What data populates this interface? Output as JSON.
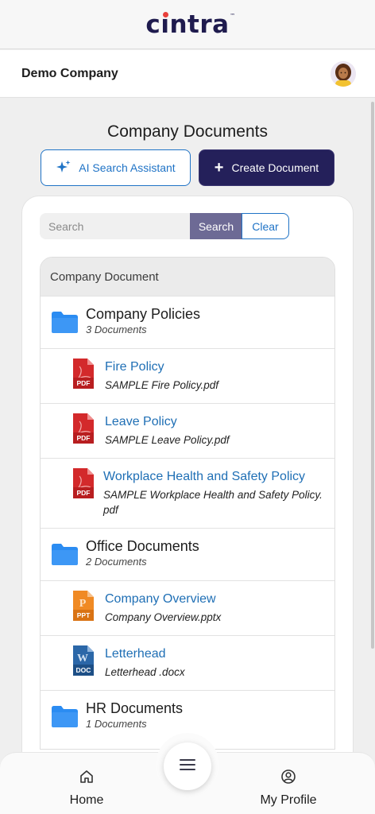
{
  "app": {
    "logo_text": "cintra",
    "logo_tm": "™"
  },
  "company": {
    "name": "Demo Company"
  },
  "page": {
    "title": "Company Documents"
  },
  "actions": {
    "ai_search_label": "AI Search Assistant",
    "create_label": "Create Document"
  },
  "search": {
    "placeholder": "Search",
    "search_label": "Search",
    "clear_label": "Clear"
  },
  "list": {
    "header": "Company Document",
    "folders": [
      {
        "title": "Company Policies",
        "count": "3 Documents",
        "files": [
          {
            "title": "Fire Policy",
            "filename": "SAMPLE Fire Policy.pdf",
            "type": "PDF",
            "color": "#d3292b"
          },
          {
            "title": "Leave Policy",
            "filename": "SAMPLE Leave Policy.pdf",
            "type": "PDF",
            "color": "#d3292b"
          },
          {
            "title": "Workplace Health and Safety Policy",
            "filename": "SAMPLE Workplace Health and Safety Policy.pdf",
            "type": "PDF",
            "color": "#d3292b"
          }
        ]
      },
      {
        "title": "Office Documents",
        "count": "2 Documents",
        "files": [
          {
            "title": "Company Overview",
            "filename": "Company Overview.pptx",
            "type": "PPT",
            "color": "#f08a24"
          },
          {
            "title": "Letterhead",
            "filename": "Letterhead .docx",
            "type": "DOC",
            "color": "#2b67a8"
          }
        ]
      },
      {
        "title": "HR Documents",
        "count": "1 Documents",
        "files": []
      }
    ]
  },
  "nav": {
    "home_label": "Home",
    "profile_label": "My Profile"
  },
  "colors": {
    "brand_navy": "#24205a",
    "accent_blue": "#1f73c6",
    "folder_blue": "#2b8cf2"
  }
}
